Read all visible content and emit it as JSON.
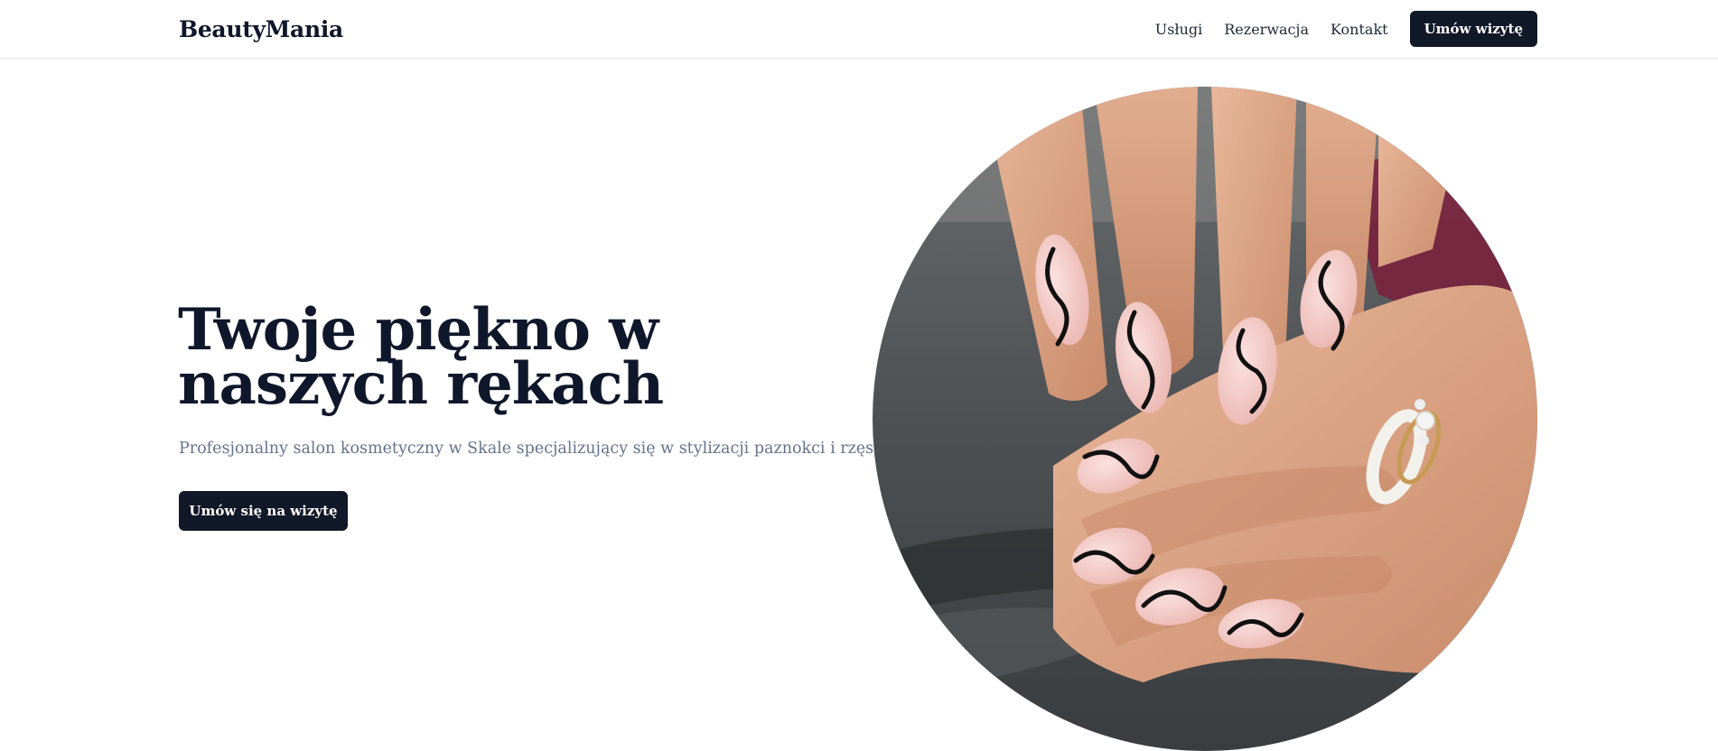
{
  "header": {
    "brand": "BeautyMania",
    "nav": [
      {
        "label": "Usługi"
      },
      {
        "label": "Rezerwacja"
      },
      {
        "label": "Kontakt"
      }
    ],
    "cta_label": "Umów wizytę"
  },
  "hero": {
    "title": "Twoje piękno w naszych rękach",
    "subtitle": "Profesjonalny salon kosmetyczny w Skale specjalizujący się w stylizacji paznokci i rzęs",
    "cta_label": "Umów się na wizytę",
    "image_description": "manicure-hands-photo"
  },
  "colors": {
    "primary": "#111827",
    "text": "#0f172a",
    "muted": "#64748b",
    "border": "#e5e7eb",
    "background": "#ffffff"
  }
}
